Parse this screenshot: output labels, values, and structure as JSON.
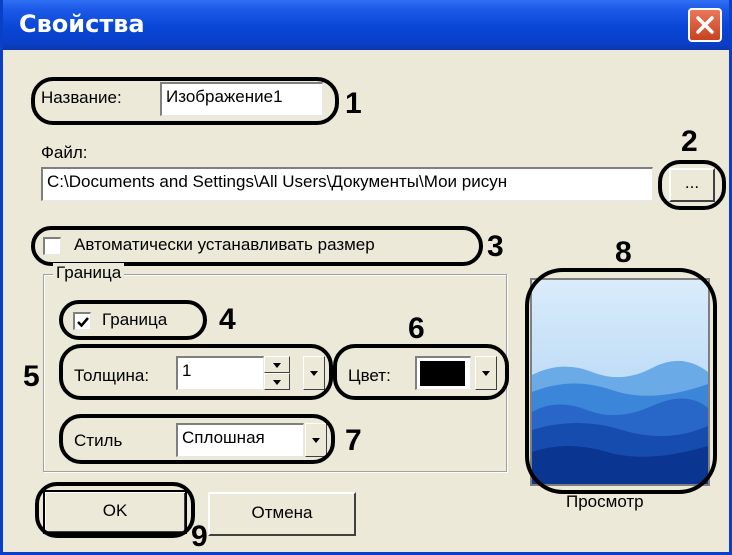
{
  "dialog": {
    "title": "Свойства"
  },
  "name": {
    "label": "Название:",
    "value": "Изображение1"
  },
  "file": {
    "label": "Файл:",
    "value": "C:\\Documents and Settings\\All Users\\Документы\\Мои рисун",
    "browse_label": "..."
  },
  "autosize": {
    "label": "Автоматически устанавливать размер",
    "checked": false
  },
  "border": {
    "group_label": "Граница",
    "checkbox_label": "Граница",
    "checked": true,
    "thickness_label": "Толщина:",
    "thickness_value": "1",
    "color_label": "Цвет:",
    "color_value": "#000000",
    "style_label": "Стиль",
    "style_value": "Сплошная"
  },
  "preview": {
    "label": "Просмотр"
  },
  "buttons": {
    "ok": "OK",
    "cancel": "Отмена"
  },
  "callouts": {
    "c1": "1",
    "c2": "2",
    "c3": "3",
    "c4": "4",
    "c5": "5",
    "c6": "6",
    "c7": "7",
    "c8": "8",
    "c9": "9"
  }
}
